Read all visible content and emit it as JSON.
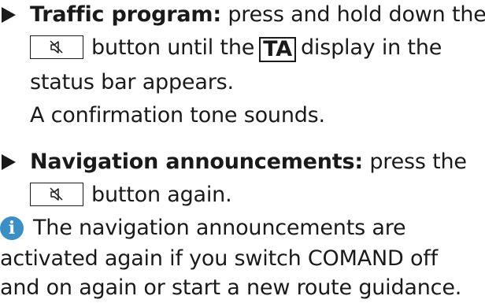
{
  "items": [
    {
      "title": "Traffic program:",
      "lines": [
        " press and hold down the",
        "button until the",
        "display in the",
        "status bar appears.",
        "A confirmation tone sounds."
      ],
      "display_label": "TA",
      "button_icon": "speaker-mute-icon"
    },
    {
      "title": "Navigation announcements:",
      "lines": [
        " press the",
        "button again."
      ],
      "button_icon": "speaker-mute-icon"
    }
  ],
  "note": {
    "icon": "info-icon",
    "icon_glyph": "i",
    "icon_color": "#3a8fc7",
    "lines": [
      "The navigation announcements are",
      "activated again if you switch COMAND off",
      "and on again or start a new route guidance."
    ]
  }
}
